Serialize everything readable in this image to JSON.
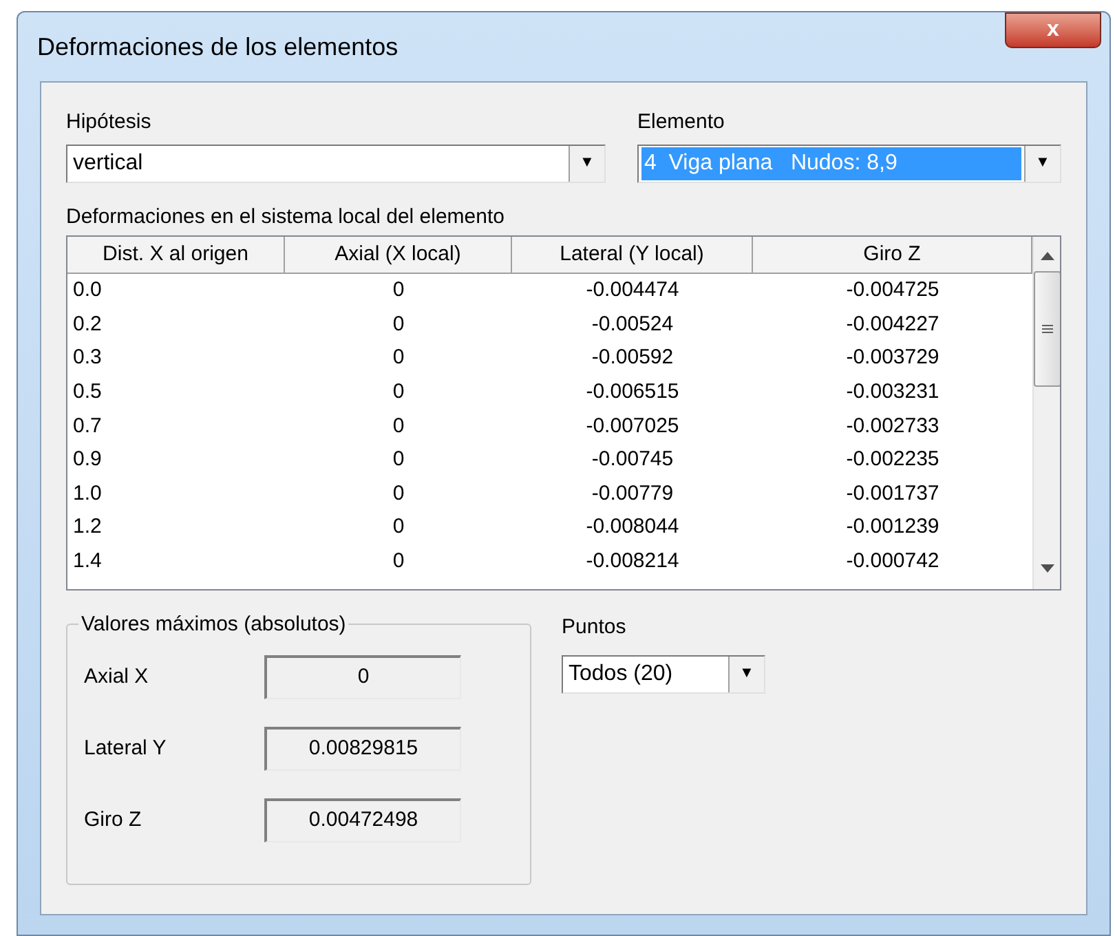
{
  "window": {
    "title": "Deformaciones de los elementos",
    "close": "x"
  },
  "hipotesis": {
    "label": "Hipótesis",
    "value": "vertical",
    "arrow": "▼"
  },
  "elemento": {
    "label": "Elemento",
    "value": "4  Viga plana   Nudos: 8,9",
    "arrow": "▼"
  },
  "table": {
    "caption": "Deformaciones en el sistema local del elemento",
    "columns": [
      "Dist. X al origen",
      "Axial (X local)",
      "Lateral (Y local)",
      "Giro Z"
    ],
    "rows": [
      [
        "0.0",
        "0",
        "-0.004474",
        "-0.004725"
      ],
      [
        "0.2",
        "0",
        "-0.00524",
        "-0.004227"
      ],
      [
        "0.3",
        "0",
        "-0.00592",
        "-0.003729"
      ],
      [
        "0.5",
        "0",
        "-0.006515",
        "-0.003231"
      ],
      [
        "0.7",
        "0",
        "-0.007025",
        "-0.002733"
      ],
      [
        "0.9",
        "0",
        "-0.00745",
        "-0.002235"
      ],
      [
        "1.0",
        "0",
        "-0.00779",
        "-0.001737"
      ],
      [
        "1.2",
        "0",
        "-0.008044",
        "-0.001239"
      ],
      [
        "1.4",
        "0",
        "-0.008214",
        "-0.000742"
      ]
    ]
  },
  "maximos": {
    "title": "Valores máximos (absolutos)",
    "fields": [
      {
        "label": "Axial X",
        "value": "0"
      },
      {
        "label": "Lateral Y",
        "value": "0.00829815"
      },
      {
        "label": "Giro Z",
        "value": "0.00472498"
      }
    ]
  },
  "puntos": {
    "label": "Puntos",
    "value": "Todos (20)",
    "arrow": "▼"
  }
}
